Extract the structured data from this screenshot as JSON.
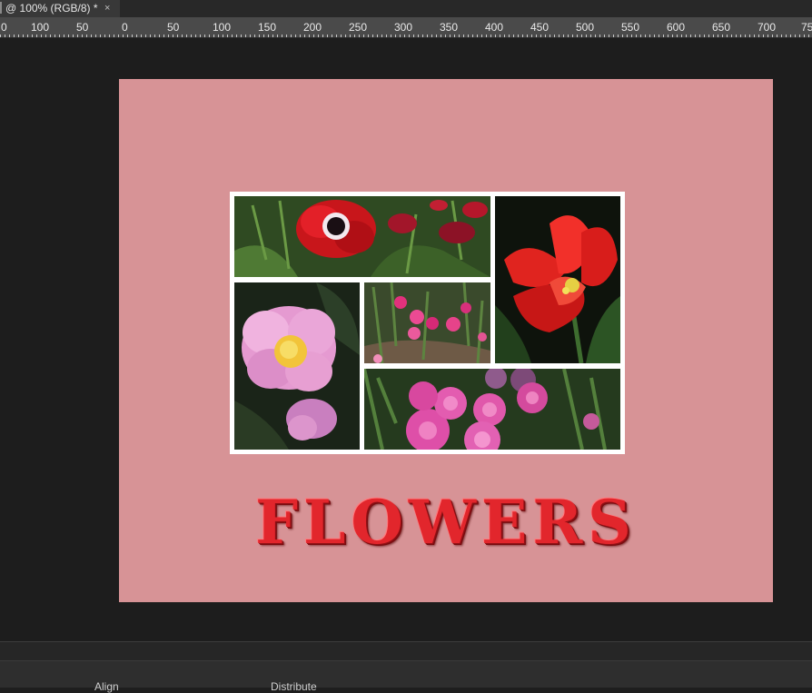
{
  "tab": {
    "title": "@ 100% (RGB/8) *",
    "close_glyph": "×"
  },
  "ruler": {
    "labels": [
      "0",
      "100",
      "50",
      "0",
      "50",
      "100",
      "150",
      "200",
      "250",
      "300",
      "350",
      "400",
      "450",
      "500",
      "550",
      "600",
      "650",
      "700",
      "75"
    ]
  },
  "document": {
    "background_color": "#d79396",
    "title": "FLOWERS",
    "photos": [
      {
        "name": "photo-red-anemone",
        "subject": "red anemone with dark center"
      },
      {
        "name": "photo-red-tulip",
        "subject": "red parrot tulip"
      },
      {
        "name": "photo-pink-camellia",
        "subject": "pink camellia"
      },
      {
        "name": "photo-pink-dianthus",
        "subject": "small pink dianthus flowers"
      },
      {
        "name": "photo-pink-ranunculus",
        "subject": "pink ranunculus cluster"
      }
    ]
  },
  "panel": {
    "align_label": "Align",
    "distribute_label": "Distribute"
  }
}
